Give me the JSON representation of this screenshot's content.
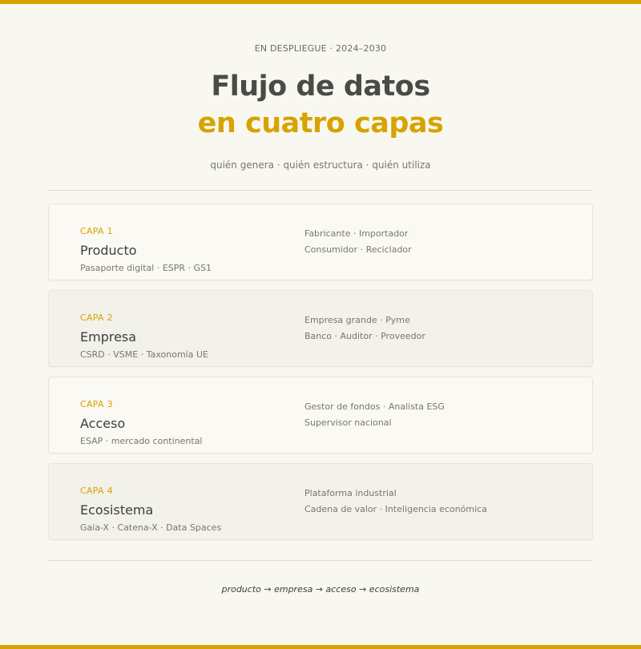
{
  "header": {
    "eyebrow": "EN DESPLIEGUE · 2024–2030",
    "title_line1": "Flujo de datos",
    "title_line2": "en cuatro capas",
    "subtitle": "quién genera · quién estructura · quién utiliza"
  },
  "layers": [
    {
      "tag": "CAPA 1",
      "name": "Producto",
      "frameworks": "Pasaporte digital · ESPR · GS1",
      "actors": [
        "Fabricante · Importador",
        "Consumidor · Reciclador"
      ]
    },
    {
      "tag": "CAPA 2",
      "name": "Empresa",
      "frameworks": "CSRD · VSME · Taxonomía UE",
      "actors": [
        "Empresa grande · Pyme",
        "Banco · Auditor · Proveedor"
      ]
    },
    {
      "tag": "CAPA 3",
      "name": "Acceso",
      "frameworks": "ESAP · mercado continental",
      "actors": [
        "Gestor de fondos · Analista ESG",
        "Supervisor nacional"
      ]
    },
    {
      "tag": "CAPA 4",
      "name": "Ecosistema",
      "frameworks": "Gaia-X · Catena-X · Data Spaces",
      "actors": [
        "Plataforma industrial",
        "Cadena de valor · Inteligencia económica"
      ]
    }
  ],
  "footer": {
    "flow": "producto → empresa → acceso → ecosistema"
  },
  "colors": {
    "accent": "#d6a300",
    "background": "#f9f8f0",
    "title": "#4a4a46"
  }
}
